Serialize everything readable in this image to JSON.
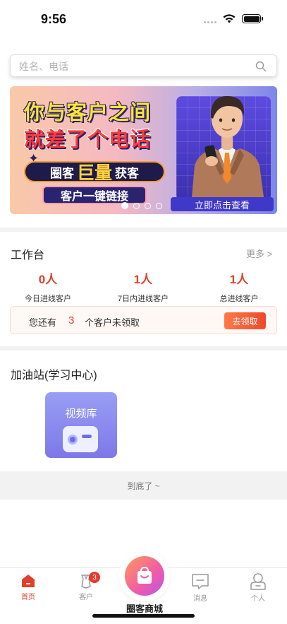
{
  "status_bar": {
    "time": "9:56"
  },
  "search": {
    "placeholder": "姓名、电话"
  },
  "banner": {
    "headline_1": "你与客户之间",
    "headline_2": "就差了个电话",
    "huoke_a": "圈客",
    "huoke_b": "巨量",
    "huoke_c": "获客",
    "link_label": "客户一键链接",
    "cta": "立即点击查看",
    "slide_count": 4,
    "active_slide": 1
  },
  "workbench": {
    "title": "工作台",
    "more": "更多 >",
    "stats": [
      {
        "value": "0人",
        "label": "今日进线客户"
      },
      {
        "value": "1人",
        "label": "7日内进线客户"
      },
      {
        "value": "1人",
        "label": "总进线客户"
      }
    ],
    "notice": {
      "prefix": "您还有",
      "count": "3",
      "suffix": "个客户未领取",
      "button": "去领取"
    }
  },
  "learning": {
    "title": "加油站(学习中心)",
    "cards": [
      {
        "label": "视频库"
      }
    ]
  },
  "footer_note": "到底了 ~",
  "tabbar": {
    "home": "首页",
    "customers": "客户",
    "customers_badge": "3",
    "mall": "圈客商城",
    "messages": "消息",
    "profile": "个人"
  },
  "colors": {
    "accent": "#e0402c",
    "banner_cta": "#3f38c9"
  }
}
